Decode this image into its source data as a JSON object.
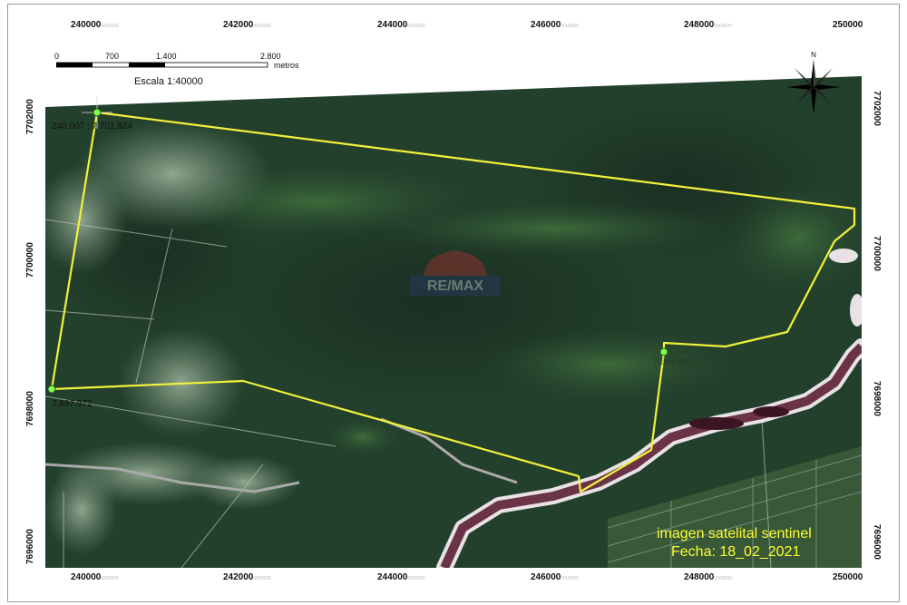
{
  "axes": {
    "x_ticks": [
      "240000",
      "242000",
      "244000",
      "246000",
      "248000",
      "250000"
    ],
    "y_ticks": [
      "7702000",
      "7700000",
      "7698000",
      "7696000"
    ],
    "tick_suffix": "0000000"
  },
  "scale_bar": {
    "labels": [
      "0",
      "700",
      "1.400",
      "2.800"
    ],
    "unit": "metros",
    "scale_text": "Escala 1:40000"
  },
  "north_arrow": {
    "letter": "N",
    "icon": "compass-rose-icon"
  },
  "points": [
    {
      "label": "240.007 ; 7.701.824"
    },
    {
      "label": "7.697.972"
    },
    {
      "label": "7.698.607"
    }
  ],
  "watermark": {
    "text": "RE/MAX"
  },
  "caption": {
    "line1": "imagen satelital sentinel",
    "line2": "Fecha: 18_02_2021"
  },
  "colors": {
    "boundary": "#f2f23a",
    "vertex": "#7cff4a",
    "caption": "#ffff33",
    "river": "#5a2a3a"
  }
}
